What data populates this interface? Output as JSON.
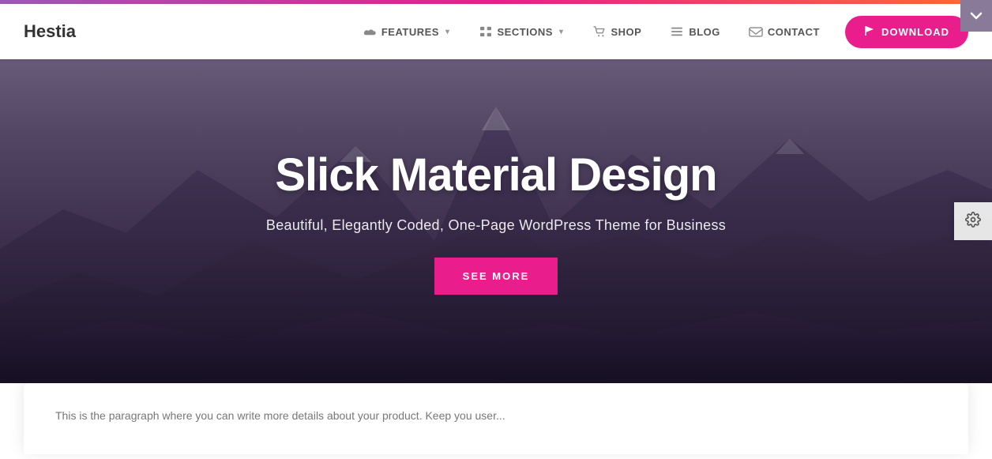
{
  "colors": {
    "accent": "#e91e8c",
    "navbar_bg": "#ffffff",
    "hero_overlay": "rgba(40,30,60,0.55)",
    "top_bar_start": "#9b59b6",
    "top_bar_end": "#ff6b35",
    "download_bg": "#e91e8c",
    "see_more_bg": "#e91e8c",
    "settings_bg": "#f0f0f0"
  },
  "brand": {
    "name": "Hestia"
  },
  "navbar": {
    "items": [
      {
        "label": "FEATURES",
        "has_dropdown": true,
        "icon": "cloud-icon"
      },
      {
        "label": "SECTIONS",
        "has_dropdown": true,
        "icon": "grid-icon"
      },
      {
        "label": "SHOP",
        "has_dropdown": false,
        "icon": "cart-icon"
      },
      {
        "label": "BLOG",
        "has_dropdown": false,
        "icon": "list-icon"
      },
      {
        "label": "CONTACT",
        "has_dropdown": false,
        "icon": "mail-icon"
      }
    ],
    "download_label": "DOWNLOAD",
    "download_icon": "flag-icon"
  },
  "hero": {
    "title": "Slick Material Design",
    "subtitle": "Beautiful, Elegantly Coded, One-Page WordPress Theme for Business",
    "cta_label": "SEE MORE"
  },
  "bottom_card": {
    "text": "This is the paragraph where you can write more details about your product. Keep you user..."
  },
  "collapse_button": {
    "icon": "chevron-down-icon"
  },
  "settings_button": {
    "icon": "gear-icon"
  }
}
